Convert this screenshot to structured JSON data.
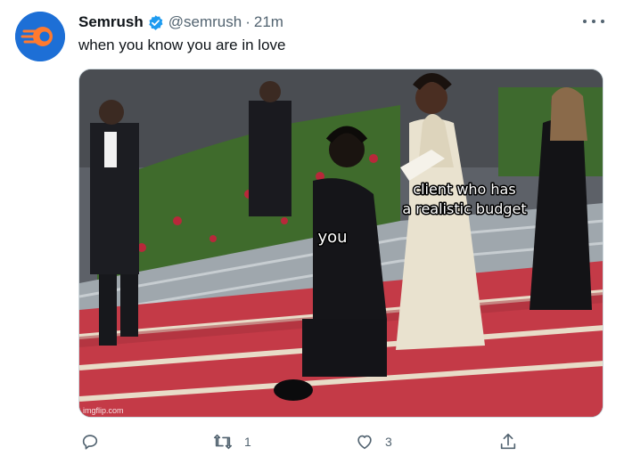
{
  "tweet": {
    "author_name": "Semrush",
    "handle": "@semrush",
    "separator": "·",
    "time": "21m",
    "text": "when you know you are in love",
    "colors": {
      "brand": "#ff642d",
      "avatar_bg": "#1d6fd6",
      "verified": "#1d9bf0"
    }
  },
  "media": {
    "caption_you": "you",
    "caption_client_line1": "client who has",
    "caption_client_line2": "a realistic budget",
    "watermark": "imgflip.com"
  },
  "actions": {
    "reply_count": "",
    "retweet_count": "1",
    "like_count": "3",
    "icons": [
      "reply-icon",
      "retweet-icon",
      "like-icon",
      "share-icon"
    ]
  }
}
